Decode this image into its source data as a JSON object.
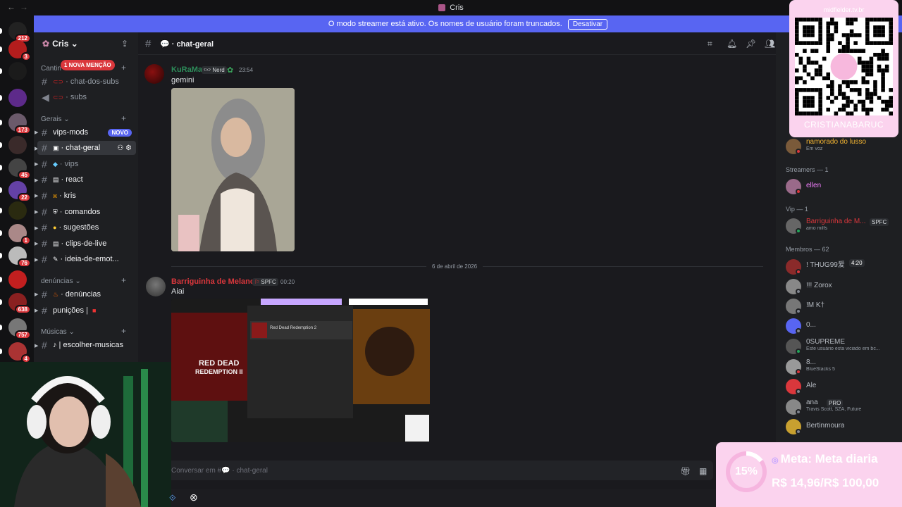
{
  "window": {
    "title": "Cris"
  },
  "banner": {
    "text": "O modo streamer está ativo. Os nomes de usuário foram truncados.",
    "button": "Desativar"
  },
  "guilds": [
    {
      "badge": "212",
      "color": "#222"
    },
    {
      "badge": "3",
      "color": "#b31d1d"
    },
    {
      "badge": "",
      "color": "#1b1b1b"
    },
    {
      "badge": "",
      "color": "#5d2a8a"
    },
    {
      "badge": "173",
      "color": "#6b5a6b"
    },
    {
      "badge": "",
      "color": "#3a2a2a"
    },
    {
      "badge": "45",
      "color": "#444"
    },
    {
      "badge": "22",
      "color": "#6441a5"
    },
    {
      "badge": "",
      "color": "#2a2a10"
    },
    {
      "badge": "1",
      "color": "#a88"
    },
    {
      "badge": "76",
      "color": "#bbb"
    },
    {
      "badge": "",
      "color": "#c21f1f"
    },
    {
      "badge": "638",
      "color": "#8a2020"
    },
    {
      "badge": "757",
      "color": "#777"
    },
    {
      "badge": "4",
      "color": "#a33"
    }
  ],
  "server": {
    "name": "Cris"
  },
  "mention_pill": "1 NOVA MENÇÃO",
  "categories": [
    "Cantin",
    "Gerais",
    "denúncias",
    "Músicas"
  ],
  "channels": {
    "chat_dos_subs": {
      "icon": "⚪",
      "label": "· chat-dos-subs"
    },
    "subs": {
      "icon": "⚪",
      "label": "· subs"
    },
    "vips_mods": {
      "label": "vips-mods",
      "tag": "NOVO"
    },
    "chat_geral": {
      "icon": "💬",
      "label": "· chat-geral"
    },
    "vips": {
      "icon": "💎",
      "label": "· vips"
    },
    "react": {
      "icon": "📺",
      "label": "· react"
    },
    "kris": {
      "icon": "🦋",
      "label": "· kris"
    },
    "comandos": {
      "icon": "🛡",
      "label": "· comandos"
    },
    "sugestoes": {
      "icon": "💡",
      "label": "· sugestões"
    },
    "clips": {
      "icon": "📺",
      "label": "· clips-de-live"
    },
    "ideia": {
      "icon": "🎨",
      "label": "· ideia-de-emot..."
    },
    "denuncias": {
      "icon": "🔥",
      "label": "· denúncias"
    },
    "punicoes": {
      "label": "punições |"
    },
    "musicas": {
      "label": "♪ | escolher-musicas"
    }
  },
  "header": {
    "channel": "💬 · chat-geral"
  },
  "messages": [
    {
      "author": "KuRaMa",
      "tag": "Nerd",
      "time": "23:54",
      "text": "gemini"
    },
    {
      "author": "Barriguinha de Melancia",
      "tag": "SPFC",
      "time": "00:20",
      "text": "Aiai"
    }
  ],
  "date_divider": "6 de abril de 2026",
  "embed2": {
    "game": "Red Dead Redemption 2",
    "logo_line1": "RED DEAD",
    "logo_line2": "REDEMPTION II"
  },
  "composer": {
    "placeholder": "Conversar em #💬 · chat-geral"
  },
  "members": {
    "sections": [
      {
        "title": "Streamers — 1"
      },
      {
        "title": "Vip — 1"
      },
      {
        "title": "Membros — 62"
      }
    ],
    "items": [
      {
        "name": "namorado do lusso",
        "status": "Em voz",
        "color": "#f0b232"
      },
      {
        "name": "ellen",
        "status": "",
        "color": "#f47fff"
      },
      {
        "name": "Barriguinha de M...",
        "status": "amo milfs",
        "color": "#da373c",
        "tag": "SPFC"
      },
      {
        "name": "! THUG99爱",
        "status": "",
        "color": "#b5bac1",
        "tag": "4:20"
      },
      {
        "name": "!!! Zorox",
        "status": "",
        "color": "#b5bac1"
      },
      {
        "name": "!M K†",
        "status": "",
        "color": "#b5bac1"
      },
      {
        "name": "0...",
        "status": "",
        "color": "#b5bac1"
      },
      {
        "name": "0SUPREME",
        "status": "Este usuário esta viciado em bc...",
        "color": "#b5bac1"
      },
      {
        "name": "8...",
        "status": "BlueStacks 5",
        "color": "#b5bac1"
      },
      {
        "name": "Ale",
        "status": "",
        "color": "#b5bac1"
      },
      {
        "name": "ana",
        "status": "Travis Scott, SZA, Future",
        "color": "#b5bac1",
        "tag": "PRO"
      },
      {
        "name": "Bertinmoura",
        "status": "",
        "color": "#b5bac1"
      }
    ]
  },
  "qr_overlay": {
    "url": "midfielder.tv.br",
    "name": "CRISTIANABARUC"
  },
  "goal": {
    "percent": 15,
    "percent_label": "15%",
    "title": "Meta: Meta diaria",
    "amount": "R$ 14,96/R$ 100,00"
  }
}
